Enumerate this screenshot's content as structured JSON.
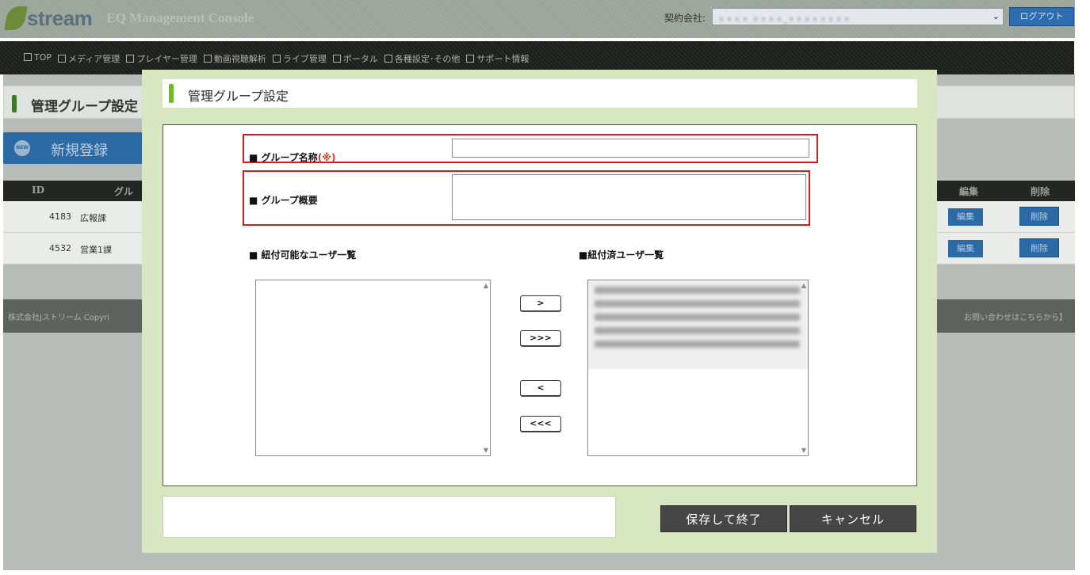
{
  "header": {
    "logo_text": "stream",
    "console_title": "EQ Management Console",
    "contract_label": "契約会社:",
    "contract_value": "ｘｘｘｘ ｘｘｘｘ_ｘｘｘｘｘｘｘｘ",
    "logout_label": "ログアウト"
  },
  "nav": {
    "items": [
      "TOP",
      "メディア管理",
      "プレイヤー管理",
      "動画視聴解析",
      "ライブ管理",
      "ポータル",
      "各種設定･その他",
      "サポート情報"
    ]
  },
  "page": {
    "heading": "管理グループ設定",
    "new_button": "新規登録",
    "new_icon_text": "NEW",
    "table_headers": {
      "id": "ID",
      "group": "グル",
      "edit": "編集",
      "delete": "削除"
    },
    "rows": [
      {
        "id": "4183",
        "name": "広報課",
        "edit": "編集",
        "delete": "削除"
      },
      {
        "id": "4532",
        "name": "営業1課",
        "edit": "編集",
        "delete": "削除"
      }
    ],
    "footer_left": "株式会社Jストリーム  Copyri",
    "footer_right": "お問い合わせはこちらから】"
  },
  "modal": {
    "title": "管理グループ設定",
    "group_name_label": "■ グループ名称",
    "required_mark": "(※)",
    "group_name_value": "",
    "group_summary_label": "■ グループ概要",
    "group_summary_value": "",
    "available_users_label": "■ 紐付可能なユーザ一覧",
    "linked_users_label": "■紐付済ユーザ一覧",
    "move_buttons": [
      ">",
      ">>>",
      "<",
      "<<<"
    ],
    "save_button": "保存して終了",
    "cancel_button": "キャンセル"
  },
  "colors": {
    "accent_green": "#6fb92d",
    "modal_bg": "#d7e8c0",
    "highlight_red": "#e3151d",
    "button_dark": "#464646",
    "nav_bg": "#1b1e1b",
    "primary_blue": "#2c6aa5"
  }
}
